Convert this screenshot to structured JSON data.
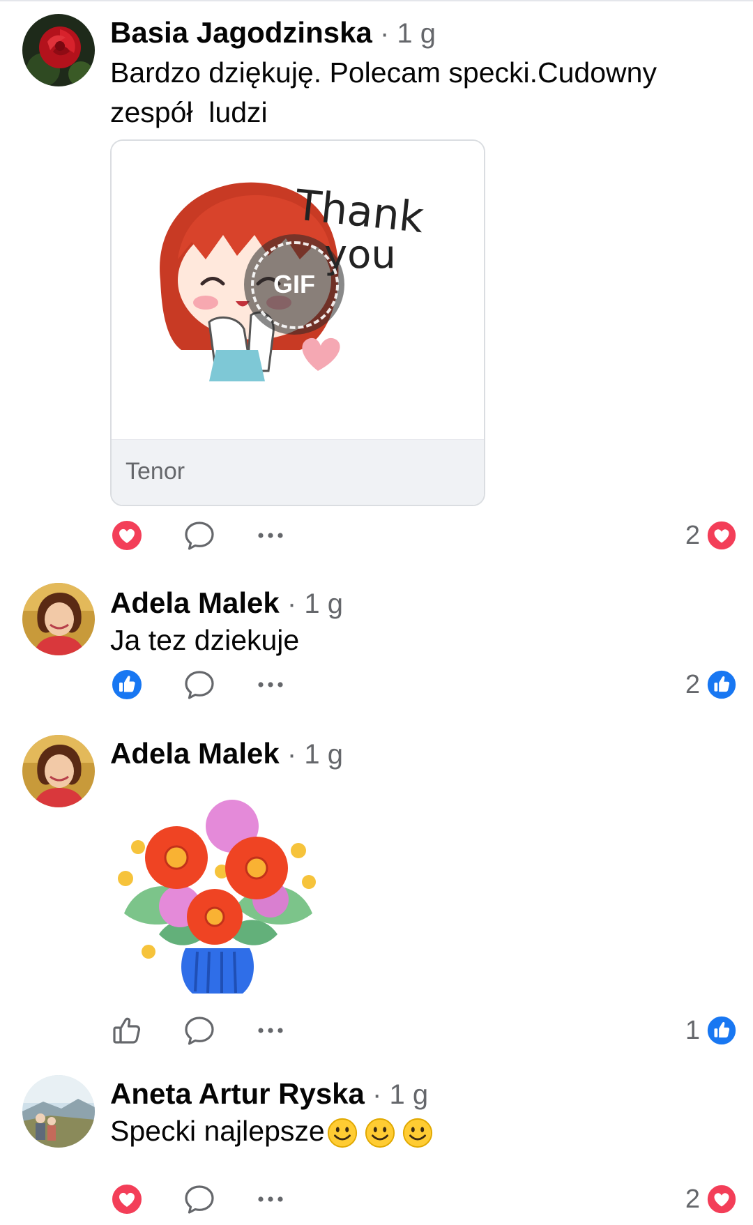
{
  "comments": [
    {
      "author": "Basia Jagodzinska",
      "time": " · 1 g",
      "text": "Bardzo dziękuję. Polecam specki.Cudowny zespół  ludzi",
      "gif": {
        "source": "Tenor",
        "badge": "GIF",
        "caption_line1": "Thank",
        "caption_line2": "you"
      },
      "reaction_count": "2",
      "reaction_type": "love"
    },
    {
      "author": "Adela Malek",
      "time": " · 1 g",
      "text": "Ja tez dziekuje",
      "reaction_count": "2",
      "reaction_type": "like"
    },
    {
      "author": "Adela Malek",
      "time": " · 1 g",
      "sticker": "flower-bouquet",
      "reaction_count": "1",
      "reaction_type": "like"
    },
    {
      "author": "Aneta Artur Ryska",
      "time": " · 1 g",
      "text": "Specki najlepsze",
      "emojis": [
        "smile",
        "smile",
        "smile"
      ],
      "reaction_count": "2",
      "reaction_type": "love"
    }
  ],
  "colors": {
    "love": "#f33e58",
    "like": "#1877f2",
    "secondary_text": "#65676b"
  },
  "icons": {
    "react": "react-icon",
    "reply": "reply-icon",
    "more": "more-icon"
  }
}
